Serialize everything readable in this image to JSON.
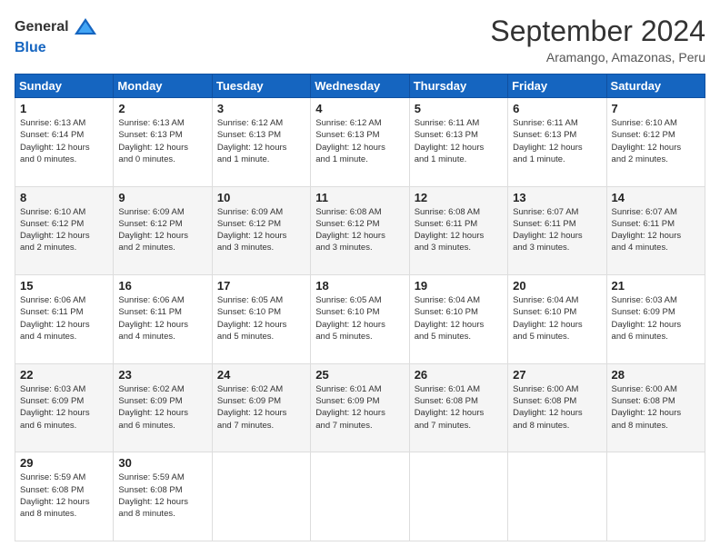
{
  "header": {
    "logo_general": "General",
    "logo_blue": "Blue",
    "month_title": "September 2024",
    "location": "Aramango, Amazonas, Peru"
  },
  "days_of_week": [
    "Sunday",
    "Monday",
    "Tuesday",
    "Wednesday",
    "Thursday",
    "Friday",
    "Saturday"
  ],
  "weeks": [
    [
      {
        "day": "1",
        "detail": "Sunrise: 6:13 AM\nSunset: 6:14 PM\nDaylight: 12 hours\nand 0 minutes."
      },
      {
        "day": "2",
        "detail": "Sunrise: 6:13 AM\nSunset: 6:13 PM\nDaylight: 12 hours\nand 0 minutes."
      },
      {
        "day": "3",
        "detail": "Sunrise: 6:12 AM\nSunset: 6:13 PM\nDaylight: 12 hours\nand 1 minute."
      },
      {
        "day": "4",
        "detail": "Sunrise: 6:12 AM\nSunset: 6:13 PM\nDaylight: 12 hours\nand 1 minute."
      },
      {
        "day": "5",
        "detail": "Sunrise: 6:11 AM\nSunset: 6:13 PM\nDaylight: 12 hours\nand 1 minute."
      },
      {
        "day": "6",
        "detail": "Sunrise: 6:11 AM\nSunset: 6:13 PM\nDaylight: 12 hours\nand 1 minute."
      },
      {
        "day": "7",
        "detail": "Sunrise: 6:10 AM\nSunset: 6:12 PM\nDaylight: 12 hours\nand 2 minutes."
      }
    ],
    [
      {
        "day": "8",
        "detail": "Sunrise: 6:10 AM\nSunset: 6:12 PM\nDaylight: 12 hours\nand 2 minutes."
      },
      {
        "day": "9",
        "detail": "Sunrise: 6:09 AM\nSunset: 6:12 PM\nDaylight: 12 hours\nand 2 minutes."
      },
      {
        "day": "10",
        "detail": "Sunrise: 6:09 AM\nSunset: 6:12 PM\nDaylight: 12 hours\nand 3 minutes."
      },
      {
        "day": "11",
        "detail": "Sunrise: 6:08 AM\nSunset: 6:12 PM\nDaylight: 12 hours\nand 3 minutes."
      },
      {
        "day": "12",
        "detail": "Sunrise: 6:08 AM\nSunset: 6:11 PM\nDaylight: 12 hours\nand 3 minutes."
      },
      {
        "day": "13",
        "detail": "Sunrise: 6:07 AM\nSunset: 6:11 PM\nDaylight: 12 hours\nand 3 minutes."
      },
      {
        "day": "14",
        "detail": "Sunrise: 6:07 AM\nSunset: 6:11 PM\nDaylight: 12 hours\nand 4 minutes."
      }
    ],
    [
      {
        "day": "15",
        "detail": "Sunrise: 6:06 AM\nSunset: 6:11 PM\nDaylight: 12 hours\nand 4 minutes."
      },
      {
        "day": "16",
        "detail": "Sunrise: 6:06 AM\nSunset: 6:11 PM\nDaylight: 12 hours\nand 4 minutes."
      },
      {
        "day": "17",
        "detail": "Sunrise: 6:05 AM\nSunset: 6:10 PM\nDaylight: 12 hours\nand 5 minutes."
      },
      {
        "day": "18",
        "detail": "Sunrise: 6:05 AM\nSunset: 6:10 PM\nDaylight: 12 hours\nand 5 minutes."
      },
      {
        "day": "19",
        "detail": "Sunrise: 6:04 AM\nSunset: 6:10 PM\nDaylight: 12 hours\nand 5 minutes."
      },
      {
        "day": "20",
        "detail": "Sunrise: 6:04 AM\nSunset: 6:10 PM\nDaylight: 12 hours\nand 5 minutes."
      },
      {
        "day": "21",
        "detail": "Sunrise: 6:03 AM\nSunset: 6:09 PM\nDaylight: 12 hours\nand 6 minutes."
      }
    ],
    [
      {
        "day": "22",
        "detail": "Sunrise: 6:03 AM\nSunset: 6:09 PM\nDaylight: 12 hours\nand 6 minutes."
      },
      {
        "day": "23",
        "detail": "Sunrise: 6:02 AM\nSunset: 6:09 PM\nDaylight: 12 hours\nand 6 minutes."
      },
      {
        "day": "24",
        "detail": "Sunrise: 6:02 AM\nSunset: 6:09 PM\nDaylight: 12 hours\nand 7 minutes."
      },
      {
        "day": "25",
        "detail": "Sunrise: 6:01 AM\nSunset: 6:09 PM\nDaylight: 12 hours\nand 7 minutes."
      },
      {
        "day": "26",
        "detail": "Sunrise: 6:01 AM\nSunset: 6:08 PM\nDaylight: 12 hours\nand 7 minutes."
      },
      {
        "day": "27",
        "detail": "Sunrise: 6:00 AM\nSunset: 6:08 PM\nDaylight: 12 hours\nand 8 minutes."
      },
      {
        "day": "28",
        "detail": "Sunrise: 6:00 AM\nSunset: 6:08 PM\nDaylight: 12 hours\nand 8 minutes."
      }
    ],
    [
      {
        "day": "29",
        "detail": "Sunrise: 5:59 AM\nSunset: 6:08 PM\nDaylight: 12 hours\nand 8 minutes."
      },
      {
        "day": "30",
        "detail": "Sunrise: 5:59 AM\nSunset: 6:08 PM\nDaylight: 12 hours\nand 8 minutes."
      },
      {
        "day": "",
        "detail": ""
      },
      {
        "day": "",
        "detail": ""
      },
      {
        "day": "",
        "detail": ""
      },
      {
        "day": "",
        "detail": ""
      },
      {
        "day": "",
        "detail": ""
      }
    ]
  ]
}
